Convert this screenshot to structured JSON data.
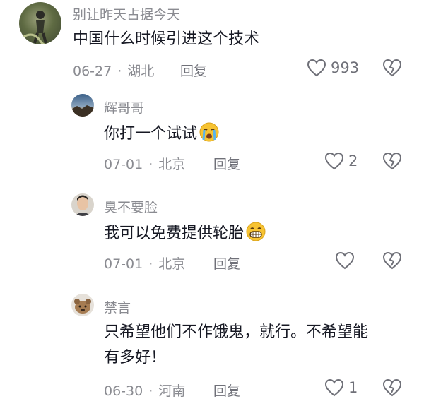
{
  "comments": [
    {
      "username": "别让昨天占据今天",
      "text": "中国什么时候引进这个技术",
      "date": "06-27",
      "location": "湖北",
      "reply_label": "回复",
      "likes": "993"
    },
    {
      "username": "辉哥哥",
      "text": "你打一个试试",
      "emoji": "crying-face",
      "date": "07-01",
      "location": "北京",
      "reply_label": "回复",
      "likes": "2"
    },
    {
      "username": "臭不要脸",
      "text": "我可以免费提供轮胎",
      "emoji": "grinning-face",
      "date": "07-01",
      "location": "北京",
      "reply_label": "回复",
      "likes": ""
    },
    {
      "username": "禁言",
      "text_line1": "只希望他们不作饿鬼，就行。不希望能",
      "text_line2": "有多好！",
      "date": "06-30",
      "location": "河南",
      "reply_label": "回复",
      "likes": "1"
    }
  ],
  "separator": "·"
}
